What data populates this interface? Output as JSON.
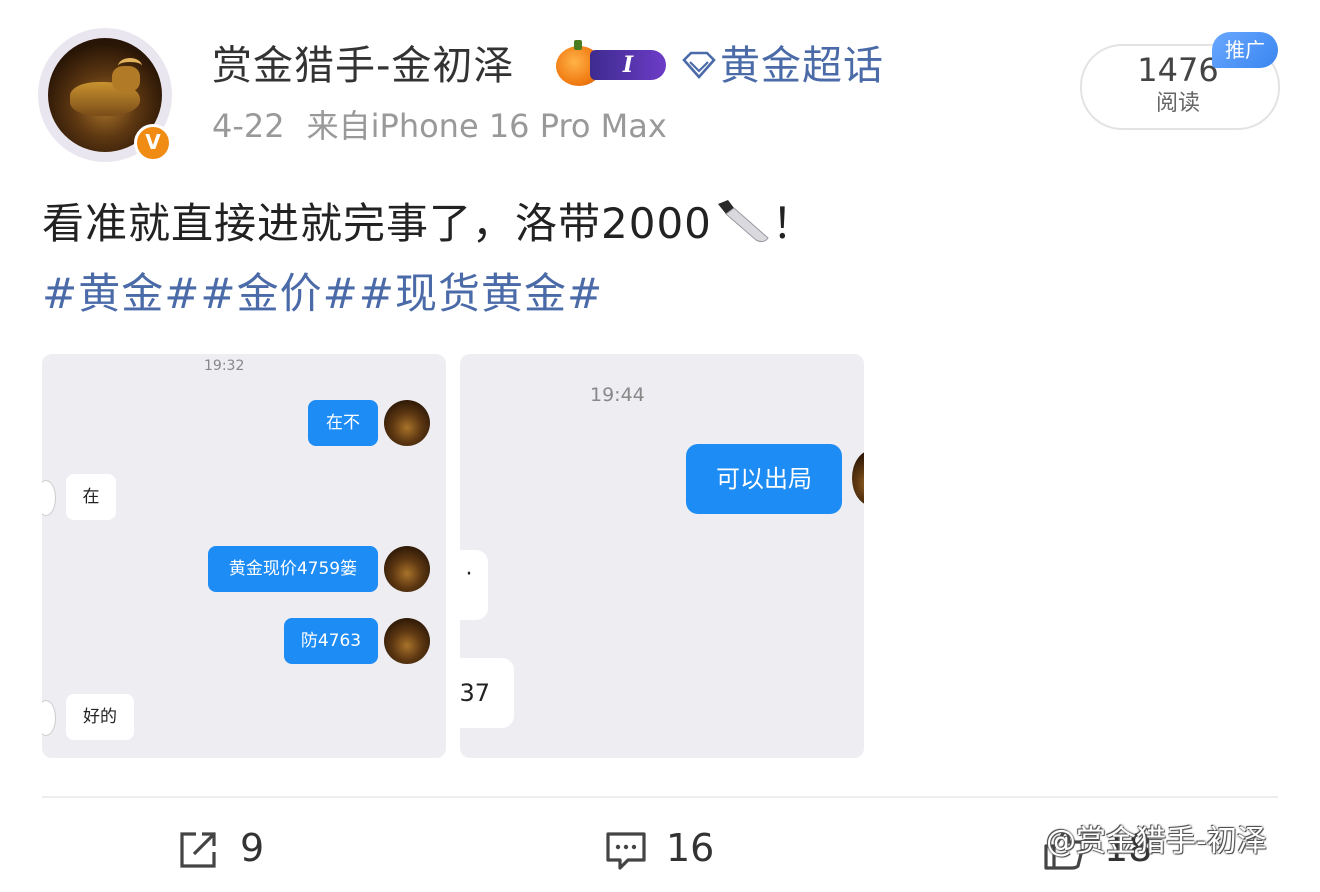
{
  "post": {
    "username": "赏金猎手-金初泽",
    "level_badge": "I",
    "super_topic": "黄金超话",
    "date": "4-22",
    "source": "来自iPhone 16 Pro Max",
    "read_count": "1476",
    "read_label": "阅读",
    "ad_tag": "推广",
    "text_before_emoji": "看准就直接进就完事了，洛带2000",
    "text_after_emoji": "！",
    "hashtags": "#黄金##金价##现货黄金#"
  },
  "image1": {
    "time": "19:32",
    "messages": [
      {
        "side": "right",
        "text": "在不"
      },
      {
        "side": "left",
        "text": "在"
      },
      {
        "side": "right",
        "text": "黄金现价4759篓"
      },
      {
        "side": "right",
        "text": "防4763"
      },
      {
        "side": "left",
        "text": "好的"
      }
    ]
  },
  "image2": {
    "time": "19:44",
    "messages": [
      {
        "side": "right",
        "text": "可以出局"
      },
      {
        "side": "left",
        "text": "·"
      },
      {
        "side": "left",
        "text": "37"
      }
    ]
  },
  "actions": {
    "share_count": "9",
    "comment_count": "16",
    "like_count": "18"
  },
  "watermark": "@赏金猎手-初泽",
  "icons": [
    "verified-v-icon",
    "pumpkin-icon",
    "diamond-icon",
    "knife-emoji-icon",
    "share-icon",
    "comment-icon",
    "like-icon"
  ],
  "colors": {
    "link": "#4a6aa8",
    "bubble_blue": "#1d8cf5",
    "verified": "#f08c14",
    "ad_tag": "#3a86f0"
  }
}
